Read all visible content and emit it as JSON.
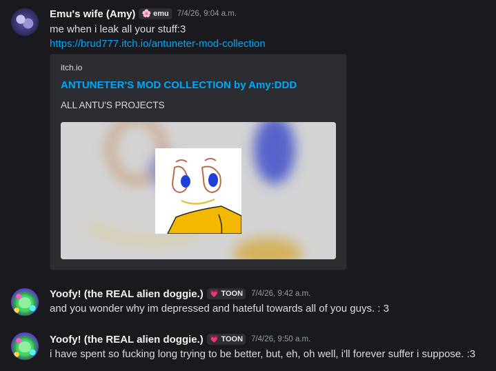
{
  "messages": [
    {
      "username": "Emu's wife (Amy)",
      "tag": {
        "icon": "flower-icon",
        "glyph": "🌸",
        "label": "emu"
      },
      "timestamp": "7/4/26, 9:04 a.m.",
      "text": "me when i leak all your stuff:3",
      "link": "https://brud777.itch.io/antuneter-mod-collection",
      "embed": {
        "provider": "itch.io",
        "title": "ANTUNETER'S MOD COLLECTION by Amy:DDD",
        "description": "ALL ANTU'S PROJECTS"
      }
    },
    {
      "username": "Yoofy! (the REAL alien doggie.)",
      "tag": {
        "icon": "heart-icon",
        "glyph": "💗",
        "label": "TOON"
      },
      "timestamp": "7/4/26, 9:42 a.m.",
      "text": "and you wonder why im depressed and hateful towards all of you guys.   : 3"
    },
    {
      "username": "Yoofy! (the REAL alien doggie.)",
      "tag": {
        "icon": "heart-icon",
        "glyph": "💗",
        "label": "TOON"
      },
      "timestamp": "7/4/26, 9:50 a.m.",
      "text": "i have spent so fucking long trying to be better, but, eh, oh well, i'll forever suffer i suppose. :3"
    }
  ],
  "colors": {
    "background": "#1a1a1e",
    "link": "#00a8fc",
    "username": "#f2f3f5",
    "timestamp": "#949ba4",
    "embed_bg": "#2b2d31"
  }
}
